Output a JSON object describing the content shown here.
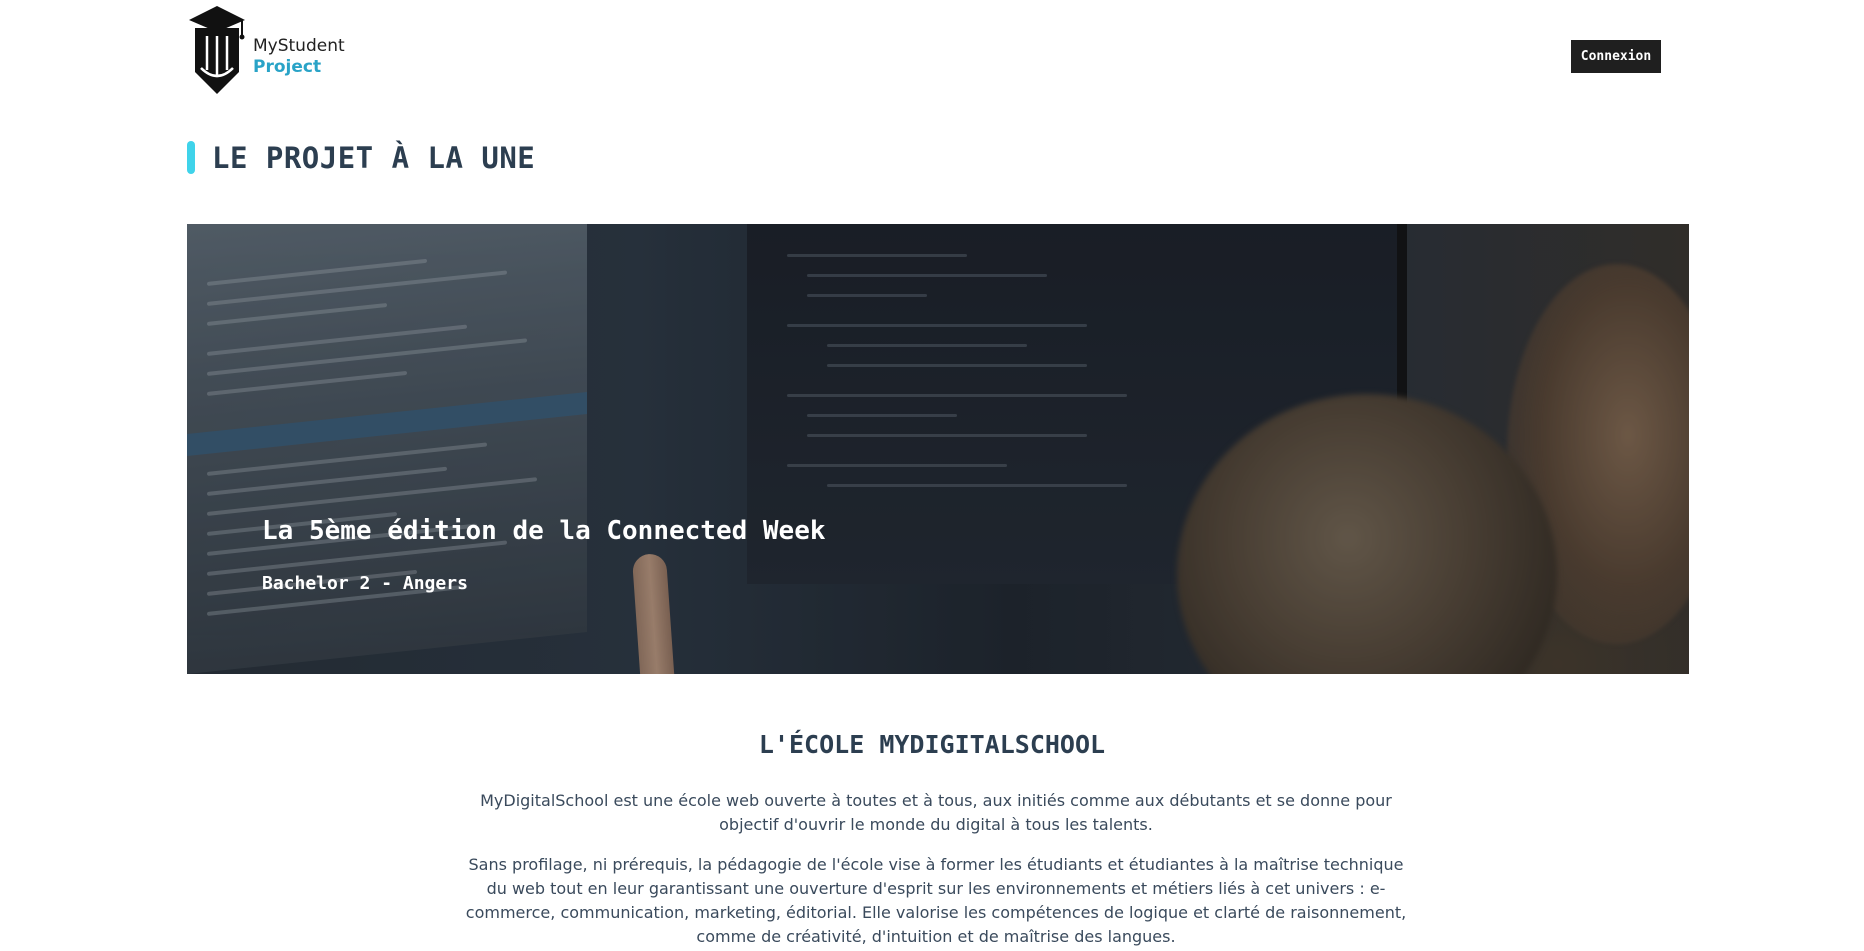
{
  "header": {
    "logo_line1": "MyStudent",
    "logo_line2": "Project",
    "login_label": "Connexion"
  },
  "featured": {
    "heading": "LE PROJET À LA UNE",
    "title": "La 5ème édition de la Connected Week",
    "subtitle": "Bachelor 2 - Angers"
  },
  "school": {
    "title": "L'ÉCOLE MYDIGITALSCHOOL",
    "paragraph1": "MyDigitalSchool est une école web ouverte à toutes et à tous, aux initiés comme aux débutants et se donne pour objectif d'ouvrir le monde du digital à tous les talents.",
    "paragraph2": "Sans profilage, ni prérequis, la pédagogie de l'école vise à former les étudiants et étudiantes à la maîtrise technique du web tout en leur garantissant une ouverture d'esprit sur les environnements et métiers liés à cet univers : e-commerce, communication, marketing, éditorial. Elle valorise les compétences de logique et clarté de raisonnement, comme de créativité, d'intuition et de maîtrise des langues."
  },
  "colors": {
    "accent": "#3fd3ea",
    "brand_blue": "#29a3c7",
    "dark": "#1f1f1f",
    "heading": "#2c3e50"
  },
  "icons": {
    "logo": "graduation-pencil-icon"
  }
}
